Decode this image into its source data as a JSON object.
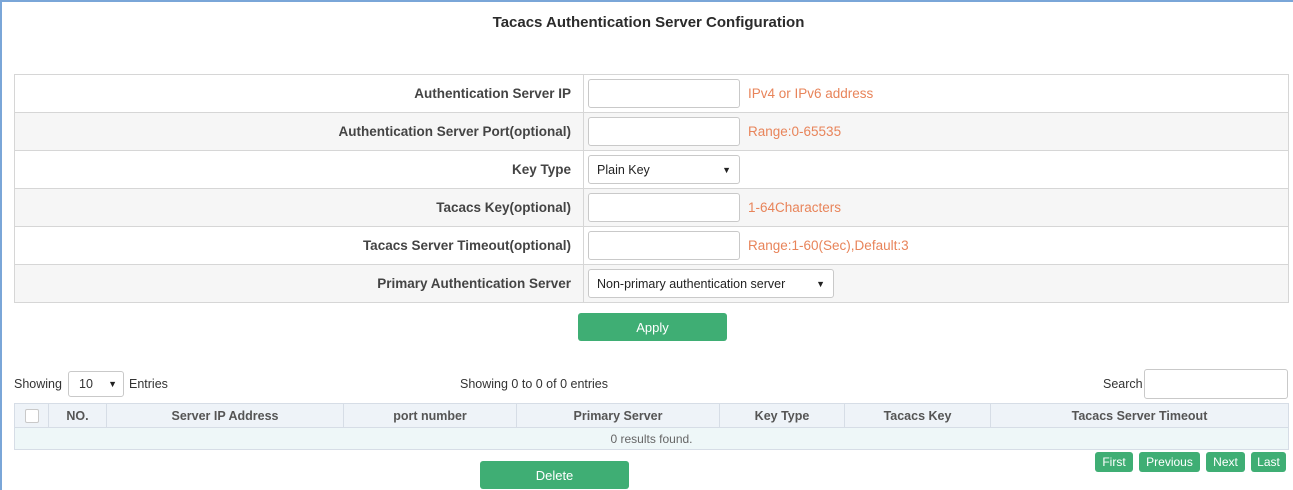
{
  "title": "Tacacs Authentication Server Configuration",
  "form": {
    "server_ip": {
      "label": "Authentication Server IP",
      "value": "",
      "hint": "IPv4 or IPv6 address"
    },
    "server_port": {
      "label": "Authentication Server Port(optional)",
      "value": "",
      "hint": "Range:0-65535"
    },
    "key_type": {
      "label": "Key Type",
      "selected": "Plain Key"
    },
    "tacacs_key": {
      "label": "Tacacs Key(optional)",
      "value": "",
      "hint": "1-64Characters"
    },
    "timeout": {
      "label": "Tacacs Server Timeout(optional)",
      "value": "",
      "hint": "Range:1-60(Sec),Default:3"
    },
    "primary": {
      "label": "Primary Authentication Server",
      "selected": "Non-primary authentication server"
    }
  },
  "apply_label": "Apply",
  "list": {
    "showing_label": "Showing",
    "page_length": "10",
    "entries_label": "Entries",
    "info": "Showing 0 to 0 of 0 entries",
    "search_label": "Search",
    "search_value": "",
    "columns": [
      "NO.",
      "Server IP Address",
      "port number",
      "Primary Server",
      "Key Type",
      "Tacacs Key",
      "Tacacs Server Timeout"
    ],
    "empty_text": "0 results found."
  },
  "delete_label": "Delete",
  "pagination": {
    "first": "First",
    "previous": "Previous",
    "next": "Next",
    "last": "Last"
  },
  "colors": {
    "accent_green": "#3fae74",
    "hint_orange": "#e8845a",
    "frame_blue": "#7aa6d8"
  }
}
